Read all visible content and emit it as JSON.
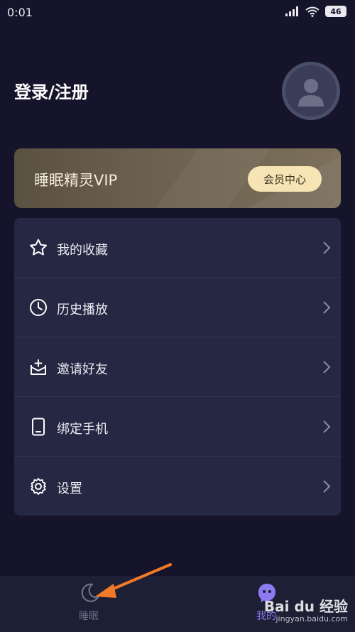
{
  "status": {
    "time": "0:01",
    "battery": "46"
  },
  "header": {
    "title": "登录/注册"
  },
  "vip": {
    "title": "睡眠精灵VIP",
    "button": "会员中心"
  },
  "menu": {
    "items": [
      {
        "label": "我的收藏",
        "icon": "star-icon"
      },
      {
        "label": "历史播放",
        "icon": "clock-icon"
      },
      {
        "label": "邀请好友",
        "icon": "invite-icon"
      },
      {
        "label": "绑定手机",
        "icon": "phone-icon"
      },
      {
        "label": "设置",
        "icon": "settings-gear-icon"
      }
    ]
  },
  "tabs": {
    "sleep": {
      "label": "睡眠",
      "icon": "moon-icon"
    },
    "mine": {
      "label": "我的",
      "icon": "mine-icon"
    }
  },
  "colors": {
    "background": "#15142b",
    "card": "#262843",
    "vip_button": "#f6e4b5",
    "active_tab": "#8d7af0",
    "annotation_arrow": "#f07a2a"
  },
  "watermark": {
    "logo": "Bai du 经验",
    "url": "jingyan.baidu.com"
  }
}
